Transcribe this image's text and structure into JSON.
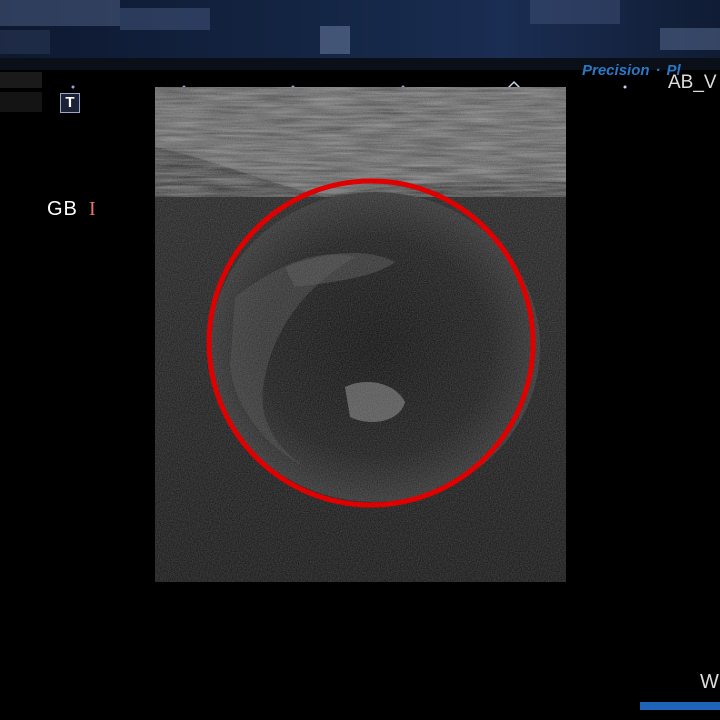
{
  "header": {
    "redacted": true
  },
  "sidebar": {
    "text_tool_icon": "T",
    "organ_label": "GB",
    "probe_orientation_marker": "I"
  },
  "brand": {
    "label": "Precision",
    "label2": "Pl"
  },
  "preset": {
    "label": "AB_V"
  },
  "footer": {
    "w_label": "W"
  },
  "colors": {
    "annotation_circle": "#e00000",
    "brand": "#2a78c8",
    "orientation_marker": "#e8795a"
  }
}
